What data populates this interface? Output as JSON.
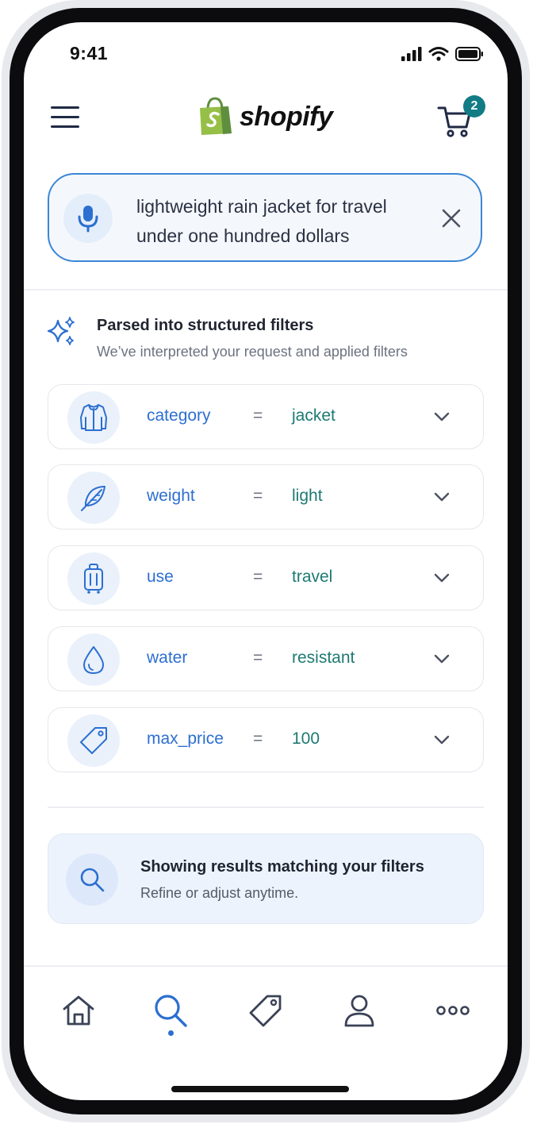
{
  "status_bar": {
    "time": "9:41"
  },
  "header": {
    "menu_icon": "hamburger-menu-icon",
    "logo_text": "shopify",
    "cart_count": "2"
  },
  "search": {
    "query": "lightweight rain jacket for travel under one hundred dollars",
    "mic_icon": "microphone-icon",
    "clear_icon": "close-icon"
  },
  "parsed": {
    "title": "Parsed into structured filters",
    "subtitle": "We’ve interpreted your request and applied filters"
  },
  "filters": [
    {
      "key": "category",
      "op": "=",
      "value": "jacket",
      "icon": "jacket-icon"
    },
    {
      "key": "weight",
      "op": "=",
      "value": "light",
      "icon": "feather-icon"
    },
    {
      "key": "use",
      "op": "=",
      "value": "travel",
      "icon": "luggage-icon"
    },
    {
      "key": "water",
      "op": "=",
      "value": "resistant",
      "icon": "droplet-icon"
    },
    {
      "key": "max_price",
      "op": "=",
      "value": "100",
      "icon": "price-tag-icon"
    }
  ],
  "results": {
    "title": "Showing results matching your filters",
    "subtitle": "Refine or adjust anytime."
  },
  "bottom_nav": {
    "items": [
      "home-icon",
      "search-icon",
      "tag-icon",
      "profile-icon",
      "more-icon"
    ],
    "active": "search-icon"
  },
  "colors": {
    "accent_blue": "#2c6fd0",
    "value_teal": "#1d7a72",
    "badge_teal": "#127c85",
    "brand_green": "#95bf47"
  }
}
